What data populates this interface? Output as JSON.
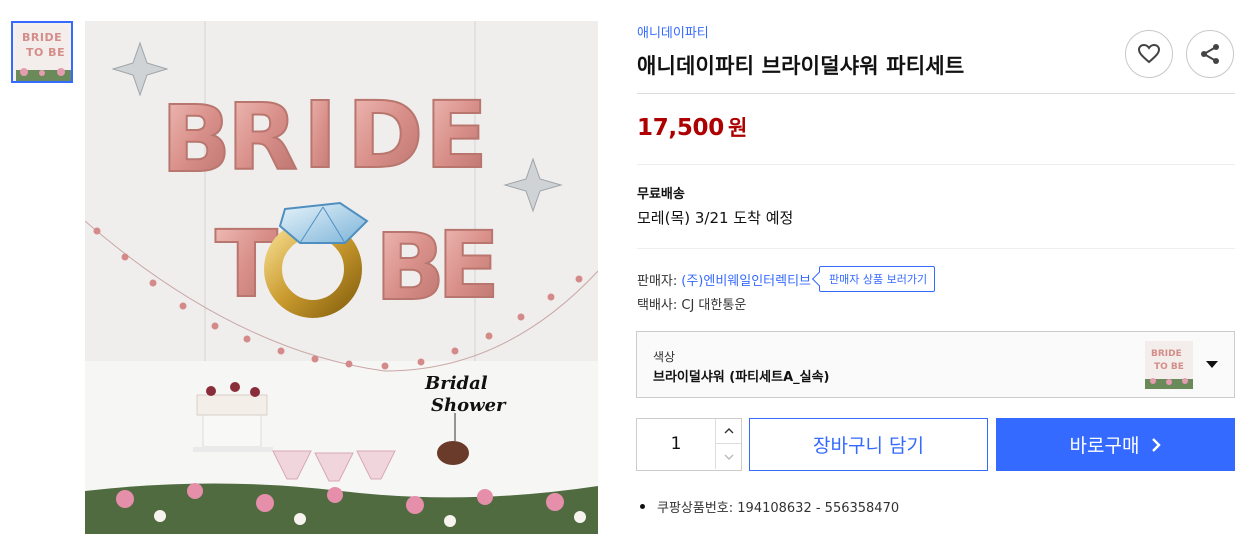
{
  "gallery": {
    "thumb_text_line1": "BRIDE",
    "thumb_text_line2": "TO BE",
    "image_letters_row1": [
      "B",
      "R",
      "I",
      "D",
      "E"
    ],
    "image_letters_row2": [
      "T",
      "B",
      "E"
    ],
    "cake_topper_line1": "Bridal",
    "cake_topper_line2": "Shower"
  },
  "product": {
    "brand": "애니데이파티",
    "title": "애니데이파티 브라이덜샤워 파티세트",
    "price": "17,500",
    "currency": "원"
  },
  "shipping": {
    "label": "무료배송",
    "arrival": "모레(목) 3/21 도착 예정"
  },
  "seller": {
    "label": "판매자:",
    "name": "(주)엔비웨일인터렉티브",
    "view_button": "판매자 상품 보러가기",
    "courier": "택배사: CJ 대한통운"
  },
  "option": {
    "label": "색상",
    "value": "브라이덜샤워 (파티세트A_실속)"
  },
  "quantity": {
    "value": "1"
  },
  "actions": {
    "cart_label": "장바구니 담기",
    "buy_label": "바로구매"
  },
  "product_id": "쿠팡상품번호: 194108632 - 556358470",
  "icons": [
    "heart-icon",
    "share-icon",
    "chevron-up-icon",
    "chevron-down-icon",
    "caret-down-icon",
    "chevron-right-icon"
  ],
  "colors": {
    "accent": "#346aff",
    "price": "#ae0000",
    "balloon": "#d48d88"
  }
}
